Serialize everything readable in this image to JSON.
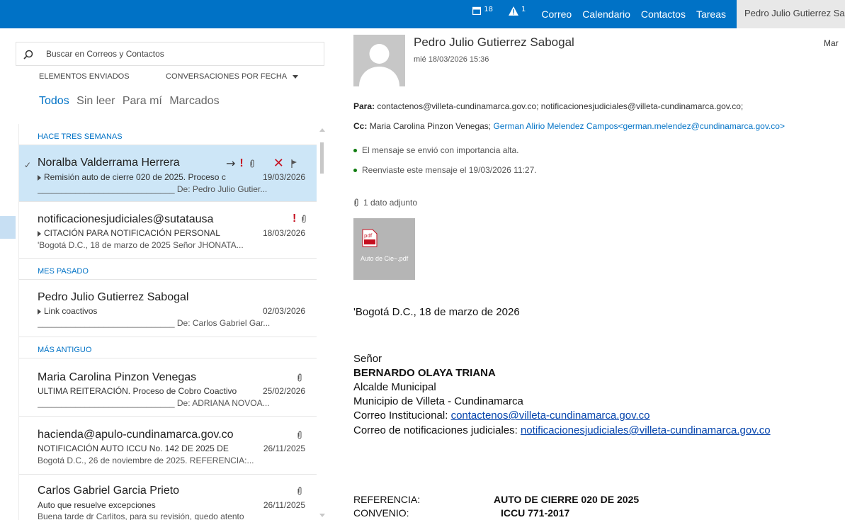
{
  "topbar": {
    "calendar_count": "18",
    "alert_count": "1",
    "nav": [
      "Correo",
      "Calendario",
      "Contactos",
      "Tareas"
    ],
    "user_name": "Pedro Julio Gutierrez Sabogal",
    "accent": "#0072c6"
  },
  "list": {
    "search_placeholder": "Buscar en Correos y Contactos",
    "folder": "ELEMENTOS ENVIADOS",
    "sort": "CONVERSACIONES POR FECHA",
    "filters": [
      "Todos",
      "Sin leer",
      "Para mí",
      "Marcados"
    ],
    "groups": [
      "HACE TRES SEMANAS",
      "MES PASADO",
      "MÁS ANTIGUO"
    ],
    "items": [
      {
        "from": "Noralba Valderrama Herrera",
        "subject": "Remisión auto de cierre 020 de 2025. Proceso c",
        "date": "19/03/2026",
        "preview": "_____________________________ De: Pedro Julio Gutier..."
      },
      {
        "from": "notificacionesjudiciales@sutatausa",
        "subject": "CITACIÓN PARA NOTIFICACIÓN PERSONAL",
        "date": "18/03/2026",
        "preview": "'Bogotá D.C., 18 de marzo de 2025 Señor JHONATA..."
      },
      {
        "from": "Pedro Julio Gutierrez Sabogal",
        "subject": "Link coactivos",
        "date": "02/03/2026",
        "preview": "_____________________________ De: Carlos Gabriel Gar..."
      },
      {
        "from": "Maria Carolina Pinzon Venegas",
        "subject": "ULTIMA REITERACIÓN. Proceso de Cobro Coactivo",
        "date": "25/02/2026",
        "preview": "_____________________________ De: ADRIANA NOVOA..."
      },
      {
        "from": "hacienda@apulo-cundinamarca.gov.co",
        "subject": "NOTIFICACIÓN AUTO ICCU No. 142 DE 2025 DE",
        "date": "26/11/2025",
        "preview": "Bogotá D.C., 26 de noviembre de 2025. REFERENCIA:..."
      },
      {
        "from": "Carlos Gabriel Garcia Prieto",
        "subject": "Auto que resuelve excepciones",
        "date": "26/11/2025",
        "preview": "Buena tarde dr Carlitos, para su revisión, quedo atento"
      }
    ]
  },
  "message": {
    "sender": "Pedro Julio Gutierrez Sabogal",
    "date": "mié 18/03/2026 15:36",
    "right_cut": "Mar",
    "to_label": "Para:",
    "to": "contactenos@villeta-cundinamarca.gov.co;  notificacionesjudiciales@villeta-cundinamarca.gov.co;",
    "cc_label": "Cc:",
    "cc_plain": "Maria Carolina Pinzon Venegas;",
    "cc_link": "German Alirio Melendez Campos<german.melendez@cundinamarca.gov.co>",
    "note_importance": "El mensaje se envió con importancia alta.",
    "note_forwarded": "Reenviaste este mensaje el 19/03/2026 11:27.",
    "attachments_label": "1 dato adjunto",
    "attachment_name": "Auto de Cie~.pdf",
    "body": {
      "line1": "'Bogotá D.C., 18 de marzo de 2026",
      "salutation": "Señor",
      "recipient": "BERNARDO OLAYA TRIANA",
      "title": "Alcalde Municipal",
      "municipality": "Municipio de Villeta - Cundinamarca",
      "inst_label": "Correo Institucional: ",
      "inst_email": "contactenos@villeta-cundinamarca.gov.co",
      "jud_label": "Correo de notificaciones judiciales: ",
      "jud_email": "notificacionesjudiciales@villeta-cundinamarca.gov.co",
      "ref_label": "REFERENCIA:",
      "ref_value": "AUTO DE CIERRE 020 DE 2025",
      "conv_label": "CONVENIO:",
      "conv_value": "ICCU 771-2017"
    }
  }
}
